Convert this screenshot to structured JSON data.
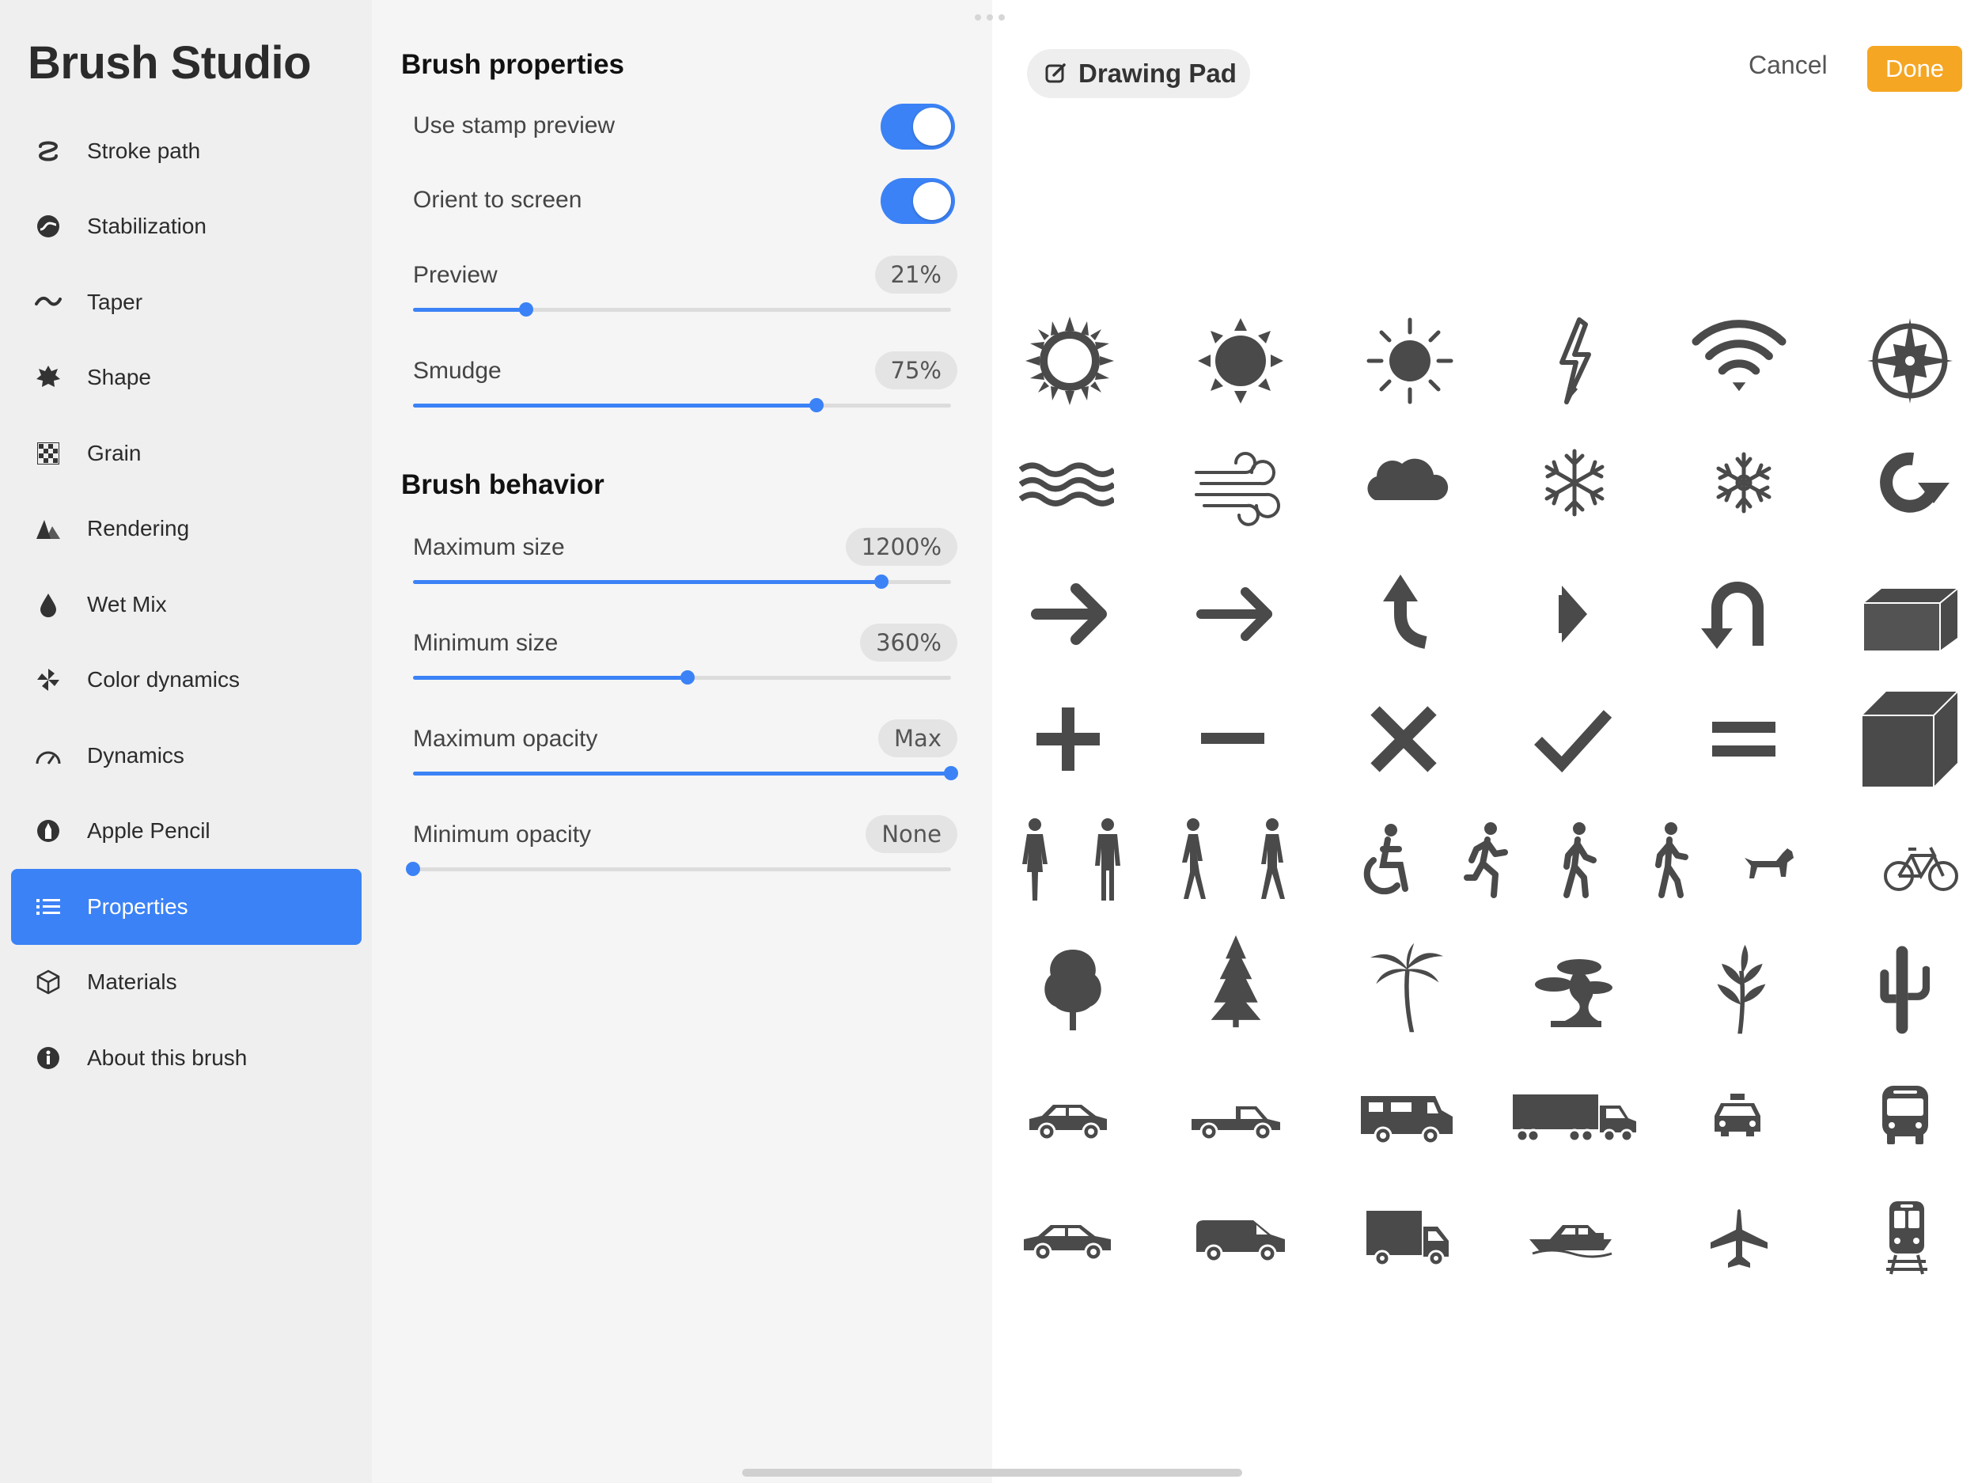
{
  "sidebar": {
    "title": "Brush Studio",
    "items": [
      {
        "label": "Stroke path",
        "icon": "stroke-path-icon"
      },
      {
        "label": "Stabilization",
        "icon": "stabilization-icon"
      },
      {
        "label": "Taper",
        "icon": "taper-icon"
      },
      {
        "label": "Shape",
        "icon": "shape-icon"
      },
      {
        "label": "Grain",
        "icon": "grain-icon"
      },
      {
        "label": "Rendering",
        "icon": "rendering-icon"
      },
      {
        "label": "Wet Mix",
        "icon": "wet-mix-icon"
      },
      {
        "label": "Color dynamics",
        "icon": "color-dynamics-icon"
      },
      {
        "label": "Dynamics",
        "icon": "dynamics-icon"
      },
      {
        "label": "Apple Pencil",
        "icon": "apple-pencil-icon"
      },
      {
        "label": "Properties",
        "icon": "properties-icon",
        "active": true
      },
      {
        "label": "Materials",
        "icon": "materials-icon"
      },
      {
        "label": "About this brush",
        "icon": "info-icon"
      }
    ]
  },
  "properties": {
    "brush_properties_title": "Brush properties",
    "use_stamp_preview": {
      "label": "Use stamp preview",
      "on": true
    },
    "orient_to_screen": {
      "label": "Orient to screen",
      "on": true
    },
    "preview": {
      "label": "Preview",
      "value": "21%",
      "fraction": 0.21
    },
    "smudge": {
      "label": "Smudge",
      "value": "75%",
      "fraction": 0.75
    },
    "brush_behavior_title": "Brush behavior",
    "maximum_size": {
      "label": "Maximum size",
      "value": "1200%",
      "fraction": 0.87
    },
    "minimum_size": {
      "label": "Minimum size",
      "value": "360%",
      "fraction": 0.51
    },
    "maximum_opacity": {
      "label": "Maximum opacity",
      "value": "Max",
      "fraction": 1.0
    },
    "minimum_opacity": {
      "label": "Minimum opacity",
      "value": "None",
      "fraction": 0.0
    }
  },
  "toolbar": {
    "drawing_pad_label": "Drawing Pad",
    "cancel_label": "Cancel",
    "done_label": "Done"
  },
  "colors": {
    "accent": "#3b82f6",
    "done": "#f5a623",
    "glyph": "#4a4a4a"
  },
  "drawing_pad": {
    "glyph_rows": [
      [
        "sun-icon",
        "sun-icon",
        "sun-icon",
        "lightning-icon",
        "wifi-icon",
        "compass-icon"
      ],
      [
        "waves-icon",
        "wind-icon",
        "cloud-icon",
        "snowflake-icon",
        "snowflake-icon",
        "redo-arrow-icon"
      ],
      [
        "arrow-right-icon",
        "arrow-right-icon",
        "turn-left-arrow-icon",
        "chevron-arrow-icon",
        "u-turn-arrow-icon",
        "box-icon"
      ],
      [
        "plus-icon",
        "minus-icon",
        "multiply-icon",
        "checkmark-icon",
        "equals-icon",
        "cube-icon"
      ],
      [
        "people-standing-icon",
        "people-walking-icon",
        "wheelchair-icon",
        "runner-icon",
        "hiker-icon",
        "walker-icon",
        "dog-icon",
        "bicycle-icon"
      ],
      [
        "tree-icon",
        "pine-tree-icon",
        "palm-tree-icon",
        "bonsai-icon",
        "plant-icon",
        "cactus-icon"
      ],
      [
        "car-icon",
        "pickup-truck-icon",
        "rv-icon",
        "semi-truck-icon",
        "taxi-icon",
        "bus-icon"
      ],
      [
        "sedan-icon",
        "van-icon",
        "box-truck-icon",
        "boat-icon",
        "airplane-icon",
        "train-icon"
      ]
    ]
  }
}
